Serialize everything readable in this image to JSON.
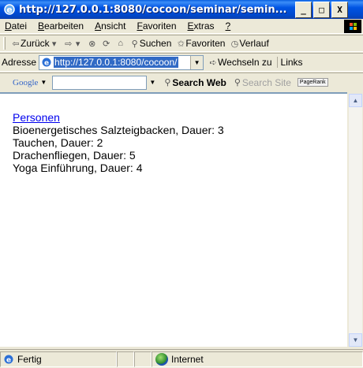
{
  "window": {
    "title": "http://127.0.0.1:8080/cocoon/seminar/semin...",
    "minimize": "_",
    "maximize": "□",
    "close": "X"
  },
  "menu": {
    "items": [
      {
        "label": "Datei",
        "ul": "D",
        "rest": "atei"
      },
      {
        "label": "Bearbeiten",
        "ul": "B",
        "rest": "earbeiten"
      },
      {
        "label": "Ansicht",
        "ul": "A",
        "rest": "nsicht"
      },
      {
        "label": "Favoriten",
        "ul": "F",
        "rest": "avoriten"
      },
      {
        "label": "Extras",
        "ul": "E",
        "rest": "xtras"
      },
      {
        "label": "?",
        "ul": "?",
        "rest": ""
      }
    ]
  },
  "toolbar": {
    "back_label": "Zurück",
    "search_label": "Suchen",
    "favorites_label": "Favoriten",
    "history_label": "Verlauf"
  },
  "address": {
    "label": "Adresse",
    "value": "http://127.0.0.1:8080/cocoon/",
    "go_label": "Wechseln zu",
    "links_label": "Links"
  },
  "google": {
    "logo": "Google",
    "search_web": "Search Web",
    "search_site": "Search Site",
    "pagerank": "PageRank"
  },
  "content": {
    "link": "Personen",
    "entries": [
      "Bioenergetisches Salzteigbacken, Dauer: 3",
      "Tauchen, Dauer: 2",
      "Drachenfliegen, Dauer: 5",
      "Yoga Einführung, Dauer: 4"
    ]
  },
  "status": {
    "text": "Fertig",
    "zone": "Internet"
  }
}
